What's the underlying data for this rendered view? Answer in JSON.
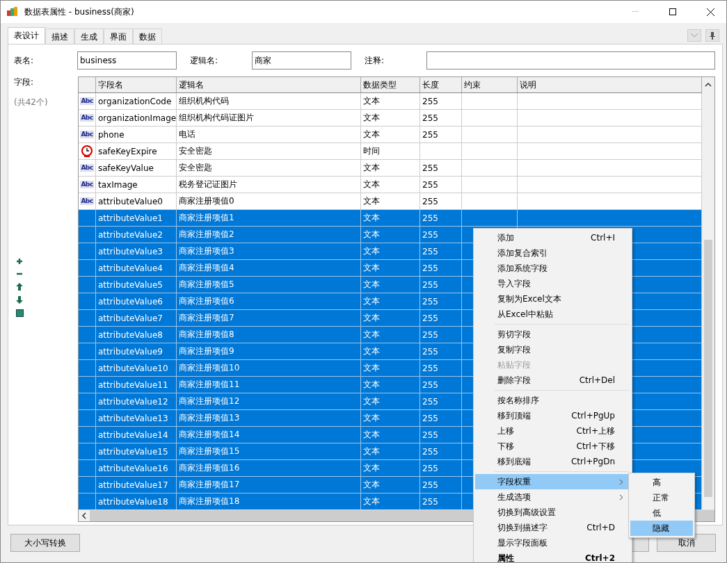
{
  "window": {
    "title": "数据表属性 - business(商家)"
  },
  "tabs": [
    {
      "label": "表设计",
      "selected": true
    },
    {
      "label": "描述",
      "selected": false
    },
    {
      "label": "生成",
      "selected": false
    },
    {
      "label": "界面",
      "selected": false
    },
    {
      "label": "数据",
      "selected": false
    }
  ],
  "form": {
    "table_name_label": "表名:",
    "table_name": "business",
    "logical_name_label": "逻辑名:",
    "logical_name": "商家",
    "comment_label": "注释:"
  },
  "fields_label": "字段:",
  "fields_count": "(共42个)",
  "table": {
    "columns": [
      "字段名",
      "逻辑名",
      "数据类型",
      "长度",
      "约束",
      "说明"
    ],
    "rows": [
      {
        "kind": "text",
        "icon": "Abc",
        "name": "organizationCode",
        "logical": "组织机构代码",
        "type": "文本",
        "length": "255",
        "selected": false
      },
      {
        "kind": "text",
        "icon": "Abc",
        "name": "organizationImage",
        "logical": "组织机构代码证图片",
        "type": "文本",
        "length": "255",
        "selected": false
      },
      {
        "kind": "text",
        "icon": "Abc",
        "name": "phone",
        "logical": "电话",
        "type": "文本",
        "length": "255",
        "selected": false
      },
      {
        "kind": "time",
        "name": "safeKeyExpire",
        "logical": "安全密匙",
        "type": "时间",
        "selected": false
      },
      {
        "kind": "text",
        "icon": "Abc",
        "name": "safeKeyValue",
        "logical": "安全密匙",
        "type": "文本",
        "length": "255",
        "selected": false
      },
      {
        "kind": "text",
        "icon": "Abc",
        "name": "taxImage",
        "logical": "税务登记证图片",
        "type": "文本",
        "length": "255",
        "selected": false
      },
      {
        "kind": "text",
        "icon": "Abc",
        "name": "attributeValue0",
        "logical": "商家注册项值0",
        "type": "文本",
        "length": "255",
        "selected": false
      },
      {
        "name": "attributeValue1",
        "logical": "商家注册项值1",
        "type": "文本",
        "length": "255",
        "selected": true
      },
      {
        "name": "attributeValue2",
        "logical": "商家注册项值2",
        "type": "文本",
        "length": "255",
        "selected": true
      },
      {
        "name": "attributeValue3",
        "logical": "商家注册项值3",
        "type": "文本",
        "length": "255",
        "selected": true
      },
      {
        "name": "attributeValue4",
        "logical": "商家注册项值4",
        "type": "文本",
        "length": "255",
        "selected": true
      },
      {
        "name": "attributeValue5",
        "logical": "商家注册项值5",
        "type": "文本",
        "length": "255",
        "selected": true
      },
      {
        "name": "attributeValue6",
        "logical": "商家注册项值6",
        "type": "文本",
        "length": "255",
        "selected": true
      },
      {
        "name": "attributeValue7",
        "logical": "商家注册项值7",
        "type": "文本",
        "length": "255",
        "selected": true
      },
      {
        "name": "attributeValue8",
        "logical": "商家注册项值8",
        "type": "文本",
        "length": "255",
        "selected": true
      },
      {
        "name": "attributeValue9",
        "logical": "商家注册项值9",
        "type": "文本",
        "length": "255",
        "selected": true
      },
      {
        "name": "attributeValue10",
        "logical": "商家注册项值10",
        "type": "文本",
        "length": "255",
        "selected": true
      },
      {
        "name": "attributeValue11",
        "logical": "商家注册项值11",
        "type": "文本",
        "length": "255",
        "selected": true
      },
      {
        "name": "attributeValue12",
        "logical": "商家注册项值12",
        "type": "文本",
        "length": "255",
        "selected": true
      },
      {
        "name": "attributeValue13",
        "logical": "商家注册项值13",
        "type": "文本",
        "length": "255",
        "selected": true
      },
      {
        "name": "attributeValue14",
        "logical": "商家注册项值14",
        "type": "文本",
        "length": "255",
        "selected": true
      },
      {
        "name": "attributeValue15",
        "logical": "商家注册项值15",
        "type": "文本",
        "length": "255",
        "selected": true
      },
      {
        "name": "attributeValue16",
        "logical": "商家注册项值16",
        "type": "文本",
        "length": "255",
        "selected": true
      },
      {
        "name": "attributeValue17",
        "logical": "商家注册项值17",
        "type": "文本",
        "length": "255",
        "selected": true
      },
      {
        "name": "attributeValue18",
        "logical": "商家注册项值18",
        "type": "文本",
        "length": "255",
        "selected": true
      }
    ]
  },
  "buttons": {
    "case_convert": "大小写转换",
    "cancel": "取消"
  },
  "context_menu": [
    {
      "kind": "item",
      "label": "添加",
      "shortcut": "Ctrl+I",
      "selected": false
    },
    {
      "kind": "item",
      "label": "添加复合索引",
      "selected": false
    },
    {
      "kind": "item",
      "label": "添加系统字段",
      "selected": false
    },
    {
      "kind": "item",
      "label": "导入字段",
      "selected": false
    },
    {
      "kind": "item",
      "label": "复制为Excel文本",
      "selected": false
    },
    {
      "kind": "item",
      "label": "从Excel中粘贴",
      "selected": false
    },
    {
      "kind": "separator"
    },
    {
      "kind": "item",
      "label": "剪切字段",
      "selected": false
    },
    {
      "kind": "item",
      "label": "复制字段",
      "selected": false
    },
    {
      "kind": "item",
      "label": "粘贴字段",
      "disabled": true,
      "selected": false
    },
    {
      "kind": "item",
      "label": "删除字段",
      "shortcut": "Ctrl+Del",
      "selected": false
    },
    {
      "kind": "separator"
    },
    {
      "kind": "item",
      "label": "按名称排序",
      "selected": false
    },
    {
      "kind": "item",
      "label": "移到顶端",
      "shortcut": "Ctrl+PgUp",
      "selected": false
    },
    {
      "kind": "item",
      "label": "上移",
      "shortcut": "Ctrl+上移",
      "selected": false
    },
    {
      "kind": "item",
      "label": "下移",
      "shortcut": "Ctrl+下移",
      "selected": false
    },
    {
      "kind": "item",
      "label": "移到底端",
      "shortcut": "Ctrl+PgDn",
      "selected": false
    },
    {
      "kind": "separator"
    },
    {
      "kind": "submenu",
      "label": "字段权重",
      "selected": true
    },
    {
      "kind": "submenu",
      "label": "生成选项",
      "selected": false
    },
    {
      "kind": "item",
      "label": "切换到高级设置",
      "selected": false
    },
    {
      "kind": "item",
      "label": "切换到描述字",
      "shortcut": "Ctrl+D",
      "selected": false
    },
    {
      "kind": "item",
      "label": "显示字段面板",
      "selected": false
    },
    {
      "kind": "item",
      "label": "属性",
      "shortcut": "Ctrl+2",
      "bold": true,
      "selected": false
    }
  ],
  "submenu": [
    {
      "label": "高",
      "selected": false
    },
    {
      "label": "正常",
      "selected": false
    },
    {
      "label": "低",
      "selected": false
    },
    {
      "label": "隐藏",
      "selected": true
    }
  ]
}
